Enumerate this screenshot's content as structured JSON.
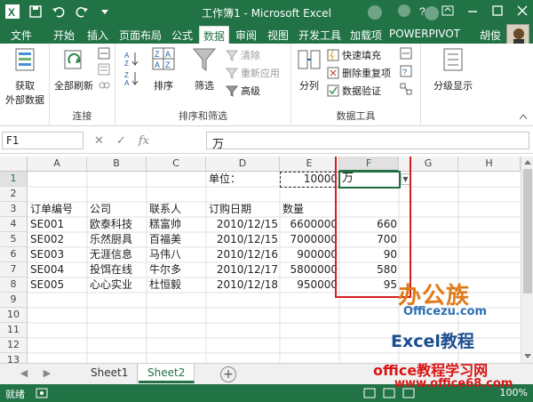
{
  "window": {
    "title": "工作簿1 - Microsoft Excel",
    "user": "胡俊"
  },
  "ribbon_tabs": [
    {
      "label": "文件"
    },
    {
      "label": "开始"
    },
    {
      "label": "插入"
    },
    {
      "label": "页面布局"
    },
    {
      "label": "公式"
    },
    {
      "label": "数据",
      "active": true
    },
    {
      "label": "审阅"
    },
    {
      "label": "视图"
    },
    {
      "label": "开发工具"
    },
    {
      "label": "加载项"
    },
    {
      "label": "POWERPIVOT"
    }
  ],
  "ribbon": {
    "get_external_1": "获取",
    "get_external_2": "外部数据",
    "refresh_all": "全部刷新",
    "connections_group": "连接",
    "sort": "排序",
    "filter": "筛选",
    "clear": "清除",
    "reapply": "重新应用",
    "advanced": "高级",
    "sort_filter_group": "排序和筛选",
    "split": "分列",
    "flash_fill": "快速填充",
    "remove_duplicates": "删除重复项",
    "data_validation": "数据验证",
    "data_tools_group": "数据工具",
    "outline": "分级显示"
  },
  "formula_bar": {
    "name_box": "F1",
    "formula": "万"
  },
  "columns": [
    "A",
    "B",
    "C",
    "D",
    "E",
    "F",
    "G",
    "H"
  ],
  "rows": [
    "1",
    "2",
    "3",
    "4",
    "5",
    "6",
    "7",
    "8",
    "9",
    "10",
    "11",
    "12",
    "13"
  ],
  "sheet": {
    "unit_label": "单位：",
    "unit_value": "10000",
    "unit_name": "万",
    "headers": [
      "订单编号",
      "公司",
      "联系人",
      "订购日期",
      "数量"
    ],
    "data_rows": [
      {
        "id": "SE001",
        "company": "欧泰科技",
        "contact": "糕富帅",
        "date": "2010/12/15",
        "qty": "6600000",
        "wan": "660"
      },
      {
        "id": "SE002",
        "company": "乐然厨具",
        "contact": "百福美",
        "date": "2010/12/15",
        "qty": "7000000",
        "wan": "700"
      },
      {
        "id": "SE003",
        "company": "无涯信息",
        "contact": "马伟八",
        "date": "2010/12/16",
        "qty": "900000",
        "wan": "90"
      },
      {
        "id": "SE004",
        "company": "投饵在线",
        "contact": "牛尔多",
        "date": "2010/12/17",
        "qty": "5800000",
        "wan": "580"
      },
      {
        "id": "SE005",
        "company": "心心实业",
        "contact": "杜恒毅",
        "date": "2010/12/18",
        "qty": "950000",
        "wan": "95"
      }
    ]
  },
  "sheet_tabs": [
    {
      "label": "Sheet1"
    },
    {
      "label": "Sheet2",
      "active": true
    }
  ],
  "status": {
    "ready": "就绪",
    "zoom": "100%"
  },
  "watermarks": {
    "logo1": "办公族",
    "logo1_sub": "Officezu.com",
    "logo2": "Excel教程",
    "site_name": "office教程学习网",
    "site_url": "www.office68.com"
  },
  "colors": {
    "excel_green": "#217346",
    "highlight_red": "#d61f1f"
  }
}
